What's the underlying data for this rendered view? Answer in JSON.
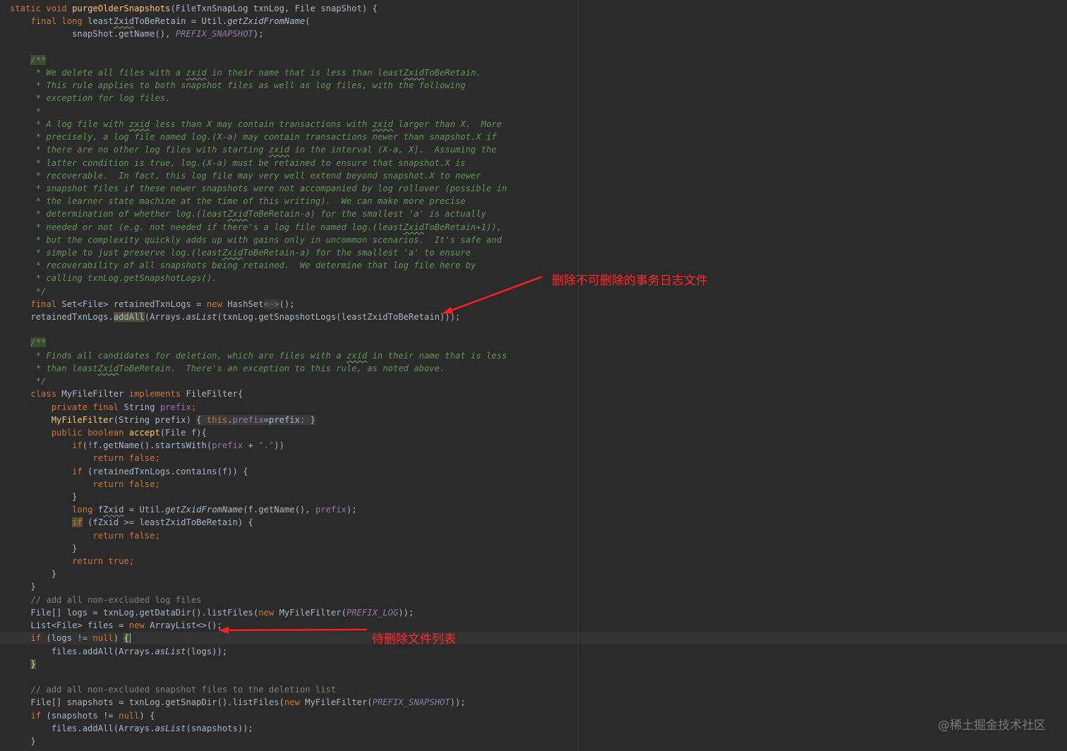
{
  "code_lines": [
    [
      [
        "kw",
        "static void "
      ],
      [
        "fn",
        "purgeOlderSnapshots"
      ],
      [
        "plain",
        "(FileTxnSnapLog txnLog, File snapShot) {"
      ]
    ],
    [
      [
        "plain",
        "    "
      ],
      [
        "kw",
        "final long "
      ],
      [
        "plain",
        "least"
      ],
      [
        "typo",
        "Zxid"
      ],
      [
        "plain",
        "ToBeRetain = Util."
      ],
      [
        "static",
        "getZxidFromName"
      ],
      [
        "plain",
        "("
      ]
    ],
    [
      [
        "plain",
        "            snapShot.getName(), "
      ],
      [
        "const",
        "PREFIX_SNAPSHOT"
      ],
      [
        "plain",
        ");"
      ]
    ],
    [],
    [
      [
        "plain",
        "    "
      ],
      [
        "doctag",
        "/**"
      ]
    ],
    [
      [
        "doc",
        "     * We delete all files with a "
      ],
      [
        "typo-doc",
        "zxid"
      ],
      [
        "doc",
        " in their name that is less than least"
      ],
      [
        "typo-doc",
        "Zxid"
      ],
      [
        "doc",
        "ToBeRetain."
      ]
    ],
    [
      [
        "doc",
        "     * This rule applies to both snapshot files as well as log files, with the following"
      ]
    ],
    [
      [
        "doc",
        "     * exception for log files."
      ]
    ],
    [
      [
        "doc",
        "     *"
      ]
    ],
    [
      [
        "doc",
        "     * A log file with "
      ],
      [
        "typo-doc",
        "zxid"
      ],
      [
        "doc",
        " less than X may contain transactions with "
      ],
      [
        "typo-doc",
        "zxid"
      ],
      [
        "doc",
        " larger than X.  More"
      ]
    ],
    [
      [
        "doc",
        "     * precisely, a log file named log.(X-a) may contain transactions newer than snapshot.X if"
      ]
    ],
    [
      [
        "doc",
        "     * there are no other log files with starting "
      ],
      [
        "typo-doc",
        "zxid"
      ],
      [
        "doc",
        " in the interval (X-a, X].  Assuming the"
      ]
    ],
    [
      [
        "doc",
        "     * latter condition is true, log.(X-a) must be retained to ensure that snapshot.X is"
      ]
    ],
    [
      [
        "doc",
        "     * recoverable.  In fact, this log file may very well extend beyond snapshot.X to newer"
      ]
    ],
    [
      [
        "doc",
        "     * snapshot files if these newer snapshots were not accompanied by log rollover (possible in"
      ]
    ],
    [
      [
        "doc",
        "     * the learner state machine at the time of this writing).  We can make more precise"
      ]
    ],
    [
      [
        "doc",
        "     * determination of whether log.(least"
      ],
      [
        "typo-doc",
        "Zxid"
      ],
      [
        "doc",
        "ToBeRetain-a) for the smallest 'a' is actually"
      ]
    ],
    [
      [
        "doc",
        "     * needed or not (e.g. not needed if there's a log file named log.(least"
      ],
      [
        "typo-doc",
        "Zxid"
      ],
      [
        "doc",
        "ToBeRetain+1)),"
      ]
    ],
    [
      [
        "doc",
        "     * but the complexity quickly adds up with gains only in uncommon scenarios.  It's safe and"
      ]
    ],
    [
      [
        "doc",
        "     * simple to just preserve log.(least"
      ],
      [
        "typo-doc",
        "Zxid"
      ],
      [
        "doc",
        "ToBeRetain-a) for the smallest 'a' to ensure"
      ]
    ],
    [
      [
        "doc",
        "     * recoverability of all snapshots being retained.  We determine that log file here by"
      ]
    ],
    [
      [
        "doc",
        "     * calling txnLog.getSnapshotLogs()."
      ]
    ],
    [
      [
        "doc",
        "     */"
      ]
    ],
    [
      [
        "plain",
        "    "
      ],
      [
        "kw",
        "final "
      ],
      [
        "plain",
        "Set<File> retainedTxnLogs = "
      ],
      [
        "kw",
        "new "
      ],
      [
        "plain",
        "HashSet"
      ],
      [
        "foldop",
        "<~>"
      ],
      [
        "plain",
        "();"
      ]
    ],
    [
      [
        "plain",
        "    retainedTxnLogs."
      ],
      [
        "warn",
        "addAll"
      ],
      [
        "plain",
        "(Arrays."
      ],
      [
        "static",
        "asList"
      ],
      [
        "plain",
        "(txnLog.getSnapshotLogs(leastZxidToBeRetain)));"
      ]
    ],
    [],
    [
      [
        "plain",
        "    "
      ],
      [
        "doctag",
        "/**"
      ]
    ],
    [
      [
        "doc",
        "     * Finds all candidates for deletion, which are files with a "
      ],
      [
        "typo-doc",
        "zxid"
      ],
      [
        "doc",
        " in their name that is less"
      ]
    ],
    [
      [
        "doc",
        "     * than least"
      ],
      [
        "typo-doc",
        "Zxid"
      ],
      [
        "doc",
        "ToBeRetain.  There's an exception to this rule, as noted above."
      ]
    ],
    [
      [
        "doc",
        "     */"
      ]
    ],
    [
      [
        "plain",
        "    "
      ],
      [
        "kw",
        "class "
      ],
      [
        "plain",
        "MyFileFilter "
      ],
      [
        "kw",
        "implements "
      ],
      [
        "plain",
        "FileFilter{"
      ]
    ],
    [
      [
        "plain",
        "        "
      ],
      [
        "kw",
        "private final "
      ],
      [
        "plain",
        "String "
      ],
      [
        "field",
        "prefix"
      ],
      [
        "kw",
        ";"
      ]
    ],
    [
      [
        "plain",
        "        "
      ],
      [
        "fn",
        "MyFileFilter"
      ],
      [
        "plain",
        "(String prefix) "
      ],
      [
        "fold",
        "{ "
      ],
      [
        "foldkw",
        "this"
      ],
      [
        "fold",
        "."
      ],
      [
        "foldfield",
        "prefix"
      ],
      [
        "fold",
        "=prefix"
      ],
      [
        "foldkw",
        ";"
      ],
      [
        "fold",
        " }"
      ]
    ],
    [
      [
        "plain",
        "        "
      ],
      [
        "kw",
        "public boolean "
      ],
      [
        "fn",
        "accept"
      ],
      [
        "plain",
        "(File f){"
      ]
    ],
    [
      [
        "plain",
        "            "
      ],
      [
        "kw",
        "if"
      ],
      [
        "plain",
        "(!f.getName().startsWith("
      ],
      [
        "field",
        "prefix"
      ],
      [
        "plain",
        " + "
      ],
      [
        "str",
        "\".\""
      ],
      [
        "plain",
        "))"
      ]
    ],
    [
      [
        "plain",
        "                "
      ],
      [
        "kw",
        "return false;"
      ]
    ],
    [
      [
        "plain",
        "            "
      ],
      [
        "kw",
        "if "
      ],
      [
        "plain",
        "(retainedTxnLogs.contains(f)) {"
      ]
    ],
    [
      [
        "plain",
        "                "
      ],
      [
        "kw",
        "return false;"
      ]
    ],
    [
      [
        "plain",
        "            }"
      ]
    ],
    [
      [
        "plain",
        "            "
      ],
      [
        "kw",
        "long "
      ],
      [
        "plain",
        "f"
      ],
      [
        "typo",
        "Zxid"
      ],
      [
        "plain",
        " = Util."
      ],
      [
        "static",
        "getZxidFromName"
      ],
      [
        "plain",
        "(f.getName(), "
      ],
      [
        "field",
        "prefix"
      ],
      [
        "plain",
        ");"
      ]
    ],
    [
      [
        "plain",
        "            "
      ],
      [
        "warn-kw",
        "if"
      ],
      [
        "plain",
        " (fZxid >= leastZxidToBeRetain) {"
      ]
    ],
    [
      [
        "plain",
        "                "
      ],
      [
        "kw",
        "return false;"
      ]
    ],
    [
      [
        "plain",
        "            }"
      ]
    ],
    [
      [
        "plain",
        "            "
      ],
      [
        "kw",
        "return true;"
      ]
    ],
    [
      [
        "plain",
        "        }"
      ]
    ],
    [
      [
        "plain",
        "    }"
      ]
    ],
    [
      [
        "plain",
        "    "
      ],
      [
        "comment",
        "// add all non-excluded log files"
      ]
    ],
    [
      [
        "plain",
        "    File[] logs = txnLog.getDataDir().listFiles("
      ],
      [
        "kw",
        "new "
      ],
      [
        "plain",
        "MyFileFilter("
      ],
      [
        "const",
        "PREFIX_LOG"
      ],
      [
        "plain",
        "));"
      ]
    ],
    [
      [
        "plain",
        "    List<File> files = "
      ],
      [
        "kw",
        "new "
      ],
      [
        "plain",
        "ArrayList<>();"
      ]
    ],
    [
      [
        "plain",
        "    "
      ],
      [
        "kw",
        "if "
      ],
      [
        "plain",
        "(logs != "
      ],
      [
        "kw",
        "null"
      ],
      [
        "plain",
        ") "
      ],
      [
        "brace",
        "{"
      ],
      [
        "cursor",
        ""
      ]
    ],
    [
      [
        "plain",
        "        files.addAll(Arrays."
      ],
      [
        "static",
        "asList"
      ],
      [
        "plain",
        "(logs));"
      ]
    ],
    [
      [
        "plain",
        "    "
      ],
      [
        "brace",
        "}"
      ]
    ],
    [],
    [
      [
        "plain",
        "    "
      ],
      [
        "comment",
        "// add all non-excluded snapshot files to the deletion list"
      ]
    ],
    [
      [
        "plain",
        "    File[] snapshots = txnLog.getSnapDir().listFiles("
      ],
      [
        "kw",
        "new "
      ],
      [
        "plain",
        "MyFileFilter("
      ],
      [
        "const",
        "PREFIX_SNAPSHOT"
      ],
      [
        "plain",
        "));"
      ]
    ],
    [
      [
        "plain",
        "    "
      ],
      [
        "kw",
        "if "
      ],
      [
        "plain",
        "(snapshots != "
      ],
      [
        "kw",
        "null"
      ],
      [
        "plain",
        ") {"
      ]
    ],
    [
      [
        "plain",
        "        files.addAll(Arrays."
      ],
      [
        "static",
        "asList"
      ],
      [
        "plain",
        "(snapshots));"
      ]
    ],
    [
      [
        "plain",
        "    }"
      ]
    ]
  ],
  "current_line": 49,
  "annotations": {
    "top": "删除不可删除的事务日志文件",
    "bottom": "待删除文件列表"
  },
  "watermark": "@稀土掘金技术社区",
  "colors": {
    "background": "#2b2b2b",
    "keyword": "#cc7832",
    "method": "#ffc66d",
    "field": "#9876aa",
    "doc_comment": "#629755",
    "comment": "#808080",
    "string": "#6a8759",
    "annotation_red": "#ff2b2b"
  }
}
